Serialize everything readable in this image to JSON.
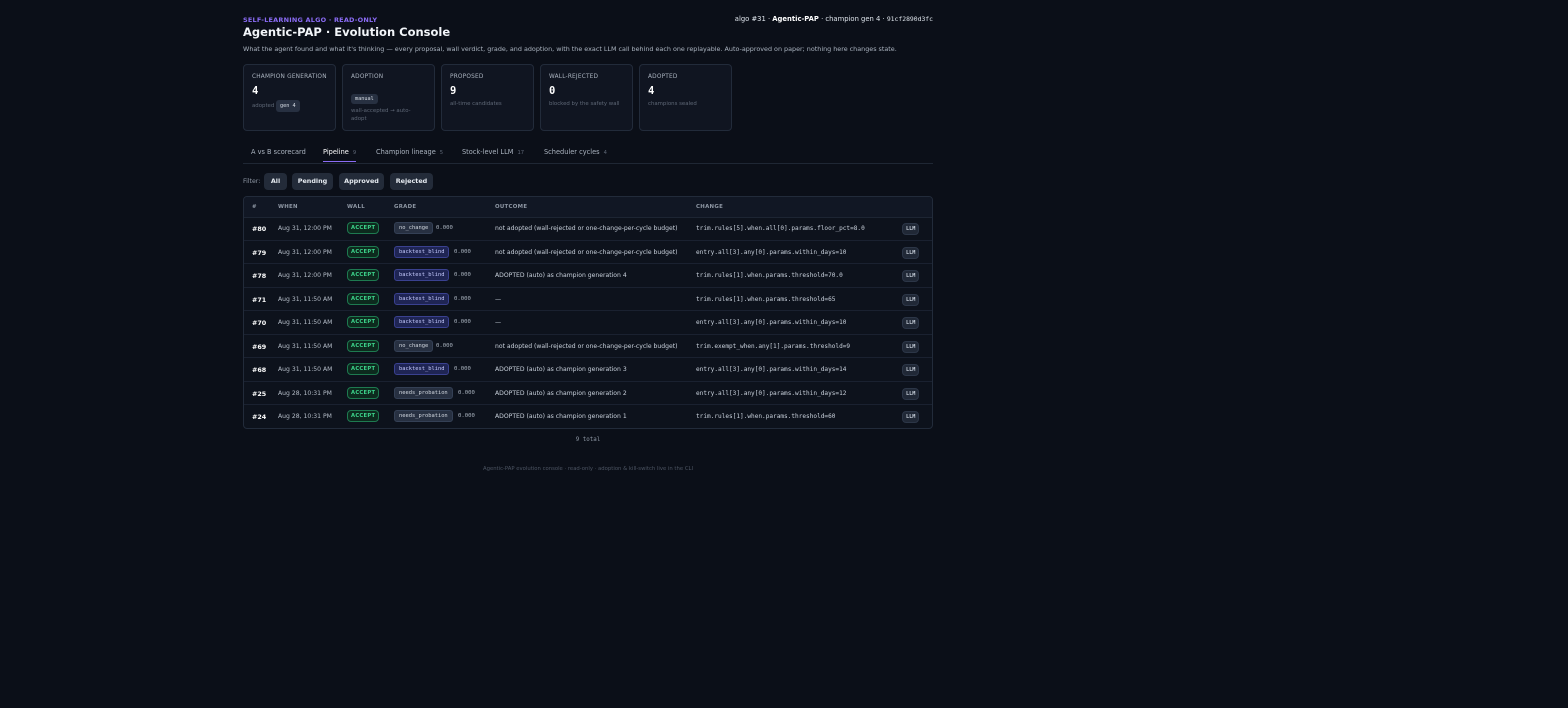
{
  "header": {
    "eyebrow": "SELF-LEARNING ALGO",
    "eyebrow_sep": " · ",
    "eyebrow_ro": "READ-ONLY",
    "title": "Agentic-PAP · Evolution Console",
    "subtitle": "What the agent found and what it's thinking — every proposal, wall verdict, grade, and adoption, with the exact LLM call behind each one replayable. Auto-approved on paper; nothing here changes state.",
    "algo": "algo #31 · ",
    "algo_name": "Agentic-PAP",
    "champion": " · champion gen 4 · ",
    "hash": "91cf2890d3fc"
  },
  "cards": [
    {
      "label": "CHAMPION GENERATION",
      "value": "4",
      "note": "adopted",
      "pill": "gen 4"
    },
    {
      "label": "ADOPTION",
      "pill": "manual",
      "note": "wall-accepted → auto-adopt"
    },
    {
      "label": "PROPOSED",
      "value": "9",
      "note": "all-time candidates"
    },
    {
      "label": "WALL-REJECTED",
      "value": "0",
      "note": "blocked by the safety wall"
    },
    {
      "label": "ADOPTED",
      "value": "4",
      "note": "champions sealed"
    }
  ],
  "tabs": [
    {
      "label": "A vs B scorecard",
      "count": ""
    },
    {
      "label": "Pipeline",
      "count": "9"
    },
    {
      "label": "Champion lineage",
      "count": "5"
    },
    {
      "label": "Stock-level LLM",
      "count": "17"
    },
    {
      "label": "Scheduler cycles",
      "count": "4"
    }
  ],
  "filter": {
    "label": "Filter:",
    "buttons": [
      "All",
      "Pending",
      "Approved",
      "Rejected"
    ]
  },
  "table": {
    "headers": [
      "#",
      "WHEN",
      "WALL",
      "GRADE",
      "OUTCOME",
      "CHANGE"
    ],
    "rows": [
      {
        "num": "#80",
        "when": "Aug 31, 12:00 PM",
        "wall": "ACCEPT",
        "grade": "no_change",
        "score": "0.000",
        "outcome": "not adopted (wall-rejected or one-change-per-cycle budget)",
        "change": "trim.rules[5].when.all[0].params.floor_pct=8.0",
        "llm": "LLM"
      },
      {
        "num": "#79",
        "when": "Aug 31, 12:00 PM",
        "wall": "ACCEPT",
        "grade": "backtest_blind",
        "score": "0.000",
        "outcome": "not adopted (wall-rejected or one-change-per-cycle budget)",
        "change": "entry.all[3].any[0].params.within_days=10",
        "llm": "LLM"
      },
      {
        "num": "#78",
        "when": "Aug 31, 12:00 PM",
        "wall": "ACCEPT",
        "grade": "backtest_blind",
        "score": "0.000",
        "outcome": "ADOPTED (auto) as champion generation 4",
        "change": "trim.rules[1].when.params.threshold=70.0",
        "llm": "LLM"
      },
      {
        "num": "#71",
        "when": "Aug 31, 11:50 AM",
        "wall": "ACCEPT",
        "grade": "backtest_blind",
        "score": "0.000",
        "outcome": "—",
        "change": "trim.rules[1].when.params.threshold=65",
        "llm": "LLM"
      },
      {
        "num": "#70",
        "when": "Aug 31, 11:50 AM",
        "wall": "ACCEPT",
        "grade": "backtest_blind",
        "score": "0.000",
        "outcome": "—",
        "change": "entry.all[3].any[0].params.within_days=10",
        "llm": "LLM"
      },
      {
        "num": "#69",
        "when": "Aug 31, 11:50 AM",
        "wall": "ACCEPT",
        "grade": "no_change",
        "score": "0.000",
        "outcome": "not adopted (wall-rejected or one-change-per-cycle budget)",
        "change": "trim.exempt_when.any[1].params.threshold=9",
        "llm": "LLM"
      },
      {
        "num": "#68",
        "when": "Aug 31, 11:50 AM",
        "wall": "ACCEPT",
        "grade": "backtest_blind",
        "score": "0.000",
        "outcome": "ADOPTED (auto) as champion generation 3",
        "change": "entry.all[3].any[0].params.within_days=14",
        "llm": "LLM"
      },
      {
        "num": "#25",
        "when": "Aug 28, 10:31 PM",
        "wall": "ACCEPT",
        "grade": "needs_probation",
        "score": "0.000",
        "outcome": "ADOPTED (auto) as champion generation 2",
        "change": "entry.all[3].any[0].params.within_days=12",
        "llm": "LLM"
      },
      {
        "num": "#24",
        "when": "Aug 28, 10:31 PM",
        "wall": "ACCEPT",
        "grade": "needs_probation",
        "score": "0.000",
        "outcome": "ADOPTED (auto) as champion generation 1",
        "change": "trim.rules[1].when.params.threshold=60",
        "llm": "LLM"
      }
    ],
    "total": "9 total"
  },
  "footer": "Agentic-PAP evolution console · read-only · adoption & kill-switch live in the CLI"
}
